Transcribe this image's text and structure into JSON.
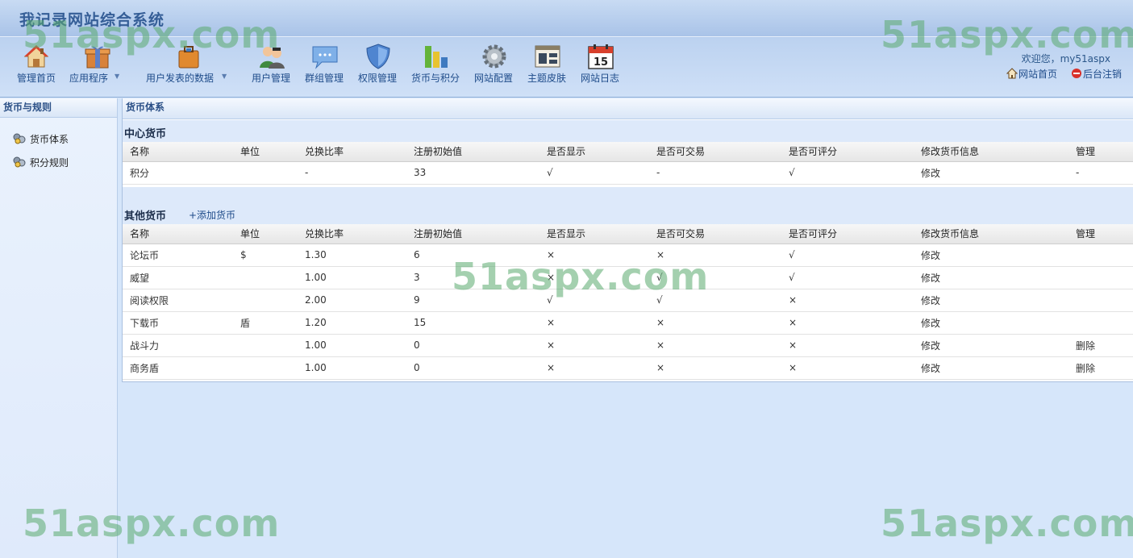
{
  "site_title": "我记录网站综合系统",
  "nav": [
    {
      "label": "管理首页",
      "icon": "house-icon"
    },
    {
      "label": "应用程序",
      "icon": "gift-box-icon",
      "dropdown": true
    },
    {
      "label": "用户发表的数据",
      "icon": "briefcase-icon",
      "dropdown": true
    },
    {
      "label": "用户管理",
      "icon": "users-icon"
    },
    {
      "label": "群组管理",
      "icon": "chat-bubble-icon"
    },
    {
      "label": "权限管理",
      "icon": "shield-icon"
    },
    {
      "label": "货币与积分",
      "icon": "bar-chart-icon"
    },
    {
      "label": "网站配置",
      "icon": "gear-icon"
    },
    {
      "label": "主题皮肤",
      "icon": "window-layout-icon"
    },
    {
      "label": "网站日志",
      "icon": "calendar-icon"
    }
  ],
  "calendar_day": "15",
  "welcome_text": "欢迎您，my51aspx",
  "top_links": {
    "home": "网站首页",
    "logout": "后台注销"
  },
  "sidebar": {
    "title": "货币与规则",
    "items": [
      {
        "label": "货币体系"
      },
      {
        "label": "积分规则"
      }
    ]
  },
  "main": {
    "title": "货币体系",
    "center_section": "中心货币",
    "other_section": "其他货币",
    "add_currency": "+添加货币",
    "columns": [
      "名称",
      "单位",
      "兑换比率",
      "注册初始值",
      "是否显示",
      "是否可交易",
      "是否可评分",
      "修改货币信息",
      "管理"
    ],
    "center_rows": [
      [
        "积分",
        "",
        "-",
        "33",
        "√",
        "-",
        "√",
        "修改",
        "-"
      ]
    ],
    "other_rows": [
      [
        "论坛币",
        "$",
        "1.30",
        "6",
        "×",
        "×",
        "√",
        "修改",
        ""
      ],
      [
        "威望",
        "",
        "1.00",
        "3",
        "×",
        "√",
        "√",
        "修改",
        ""
      ],
      [
        "阅读权限",
        "",
        "2.00",
        "9",
        "√",
        "√",
        "×",
        "修改",
        ""
      ],
      [
        "下载币",
        "盾",
        "1.20",
        "15",
        "×",
        "×",
        "×",
        "修改",
        ""
      ],
      [
        "战斗力",
        "",
        "1.00",
        "0",
        "×",
        "×",
        "×",
        "修改",
        "删除"
      ],
      [
        "商务盾",
        "",
        "1.00",
        "0",
        "×",
        "×",
        "×",
        "修改",
        "删除"
      ]
    ]
  },
  "watermark": "51aspx.com"
}
